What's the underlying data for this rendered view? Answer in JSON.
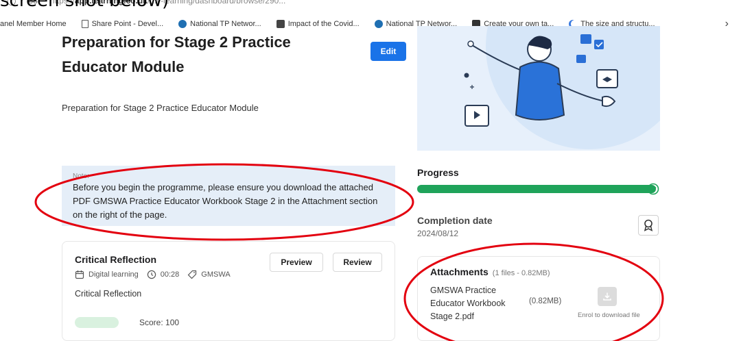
{
  "caption": "screen shot below)",
  "browser": {
    "url_host": "app.learning.co.uk",
    "url_path": "/my-learning/dashboard/browse/290..."
  },
  "bookmarks": [
    {
      "label": "anel Member Home",
      "icon": "none"
    },
    {
      "label": "Share Point - Devel...",
      "icon": "document-icon"
    },
    {
      "label": "National TP Networ...",
      "icon": "sharepoint-icon"
    },
    {
      "label": "Impact of the Covid...",
      "icon": "news-icon"
    },
    {
      "label": "National TP Networ...",
      "icon": "sharepoint-icon"
    },
    {
      "label": "Create your own ta...",
      "icon": "table-icon"
    },
    {
      "label": "The size and structu...",
      "icon": "moon-icon"
    }
  ],
  "course": {
    "title": "Preparation for Stage 2 Practice Educator Module",
    "subtitle": "Preparation for Stage 2 Practice Educator Module",
    "edit_label": "Edit"
  },
  "note": {
    "label": "Note:",
    "text": "Before you begin the programme, please ensure you download the attached PDF GMSWA Practice Educator Workbook Stage 2 in the Attachment section on the right of the page."
  },
  "activity": {
    "title": "Critical Reflection",
    "type": "Digital learning",
    "duration": "00:28",
    "tag": "GMSWA",
    "description": "Critical Reflection",
    "preview_label": "Preview",
    "review_label": "Review",
    "bottom_text": "Score: 100"
  },
  "progress": {
    "label": "Progress",
    "percent": 100
  },
  "completion": {
    "label": "Completion date",
    "date": "2024/08/12"
  },
  "attachments": {
    "title": "Attachments",
    "count": "(1 files - 0.82MB)",
    "file_name": "GMSWA Practice Educator Workbook Stage 2.pdf",
    "file_size": "(0.82MB)",
    "download_note": "Enrol to download file"
  },
  "colors": {
    "accent": "#1a73e8",
    "progress": "#1fa35a",
    "note_bg": "#e5eef8",
    "annotation": "#e3000f"
  }
}
